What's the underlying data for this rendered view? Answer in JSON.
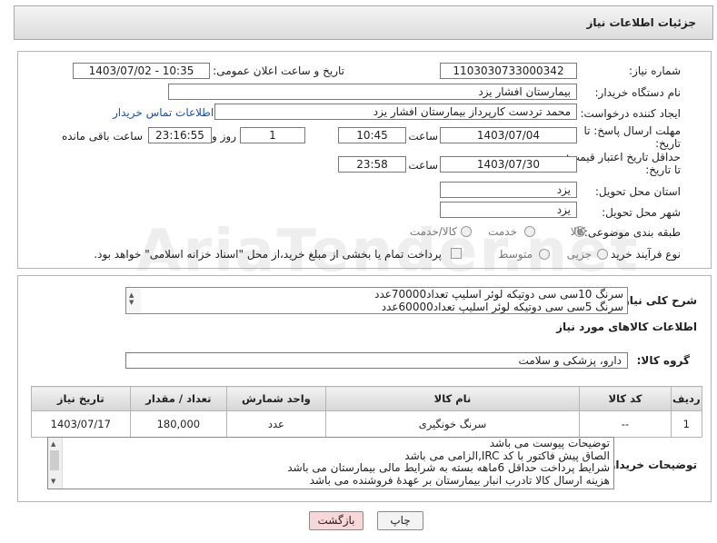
{
  "header": {
    "title": "جزئیات اطلاعات نیاز"
  },
  "watermark": "AriaTender.net",
  "form": {
    "need_number_label": "شماره نیاز:",
    "need_number": "1103030733000342",
    "announce_label": "تاریخ و ساعت اعلان عمومی:",
    "announce_value": "1403/07/02 - 10:35",
    "buyer_label": "نام دستگاه خریدار:",
    "buyer": "بیمارستان افشار یزد",
    "creator_label": "ایجاد کننده درخواست:",
    "creator": "محمد تردست کارپرداز بیمارستان افشار یزد",
    "contact_link": "اطلاعات تماس خریدار",
    "deadline_label": "مهلت ارسال پاسخ: تا تاریخ:",
    "deadline_date": "1403/07/04",
    "time_label": "ساعت",
    "deadline_time": "10:45",
    "days_value": "1",
    "days_label": "روز و",
    "remaining_time": "23:16:55",
    "remaining_label": "ساعت باقی مانده",
    "validity_label": "حداقل تاریخ اعتبار قیمت: تا تاریخ:",
    "validity_date": "1403/07/30",
    "validity_time": "23:58",
    "province_label": "استان محل تحویل:",
    "province": "یزد",
    "city_label": "شهر محل تحویل:",
    "city": "یزد",
    "category_label": "طبقه بندی موضوعی:",
    "category_options": [
      "کالا",
      "خدمت",
      "کالا/خدمت"
    ],
    "category_selected": "کالا",
    "process_label": "نوع فرآیند خرید :",
    "process_options": [
      "جزیی",
      "متوسط"
    ],
    "process_selected": "",
    "payment_note": "پرداخت تمام یا بخشی از مبلغ خرید،از محل \"اسناد خزانه اسلامی\" خواهد بود."
  },
  "summary": {
    "label": "شرح کلی نیاز:",
    "lines": [
      "سرنگ 10سی سی دوتیکه لوئر اسلیپ تعداد70000عدد",
      "سرنگ 5سی سی دوتیکه لوئر اسلیپ تعداد60000عدد"
    ]
  },
  "goods": {
    "section_title": "اطلاعات کالاهای مورد نیاز",
    "group_label": "گروه کالا:",
    "group_value": "دارو، پزشکی و سلامت",
    "columns": [
      "ردیف",
      "کد کالا",
      "نام کالا",
      "واحد شمارش",
      "تعداد / مقدار",
      "تاریخ نیاز"
    ],
    "rows": [
      {
        "index": "1",
        "code": "--",
        "name": "سرنگ خونگیری",
        "unit": "عدد",
        "qty": "180,000",
        "date": "1403/07/17"
      }
    ]
  },
  "buyer_notes": {
    "label": "توضیحات خریدار:",
    "lines": [
      "توضیحات پیوست می باشد",
      "الصاق پیش فاکتور با کد  IRC,الزامی می باشد",
      "شرایط پرداخت   حداقل 6ماهه بسته به شرایط مالی بیمارستان می باشد",
      "هزینه ارسال کالا تادرب انبار بیمارستان بر عهدهٔ فروشنده می باشد"
    ]
  },
  "buttons": {
    "print": "چاپ",
    "back": "بازگشت"
  },
  "colors": {
    "back_button_bg": "#f9d6d9",
    "print_button_bg": "#f3f3f3",
    "link": "#1a4fb5"
  }
}
